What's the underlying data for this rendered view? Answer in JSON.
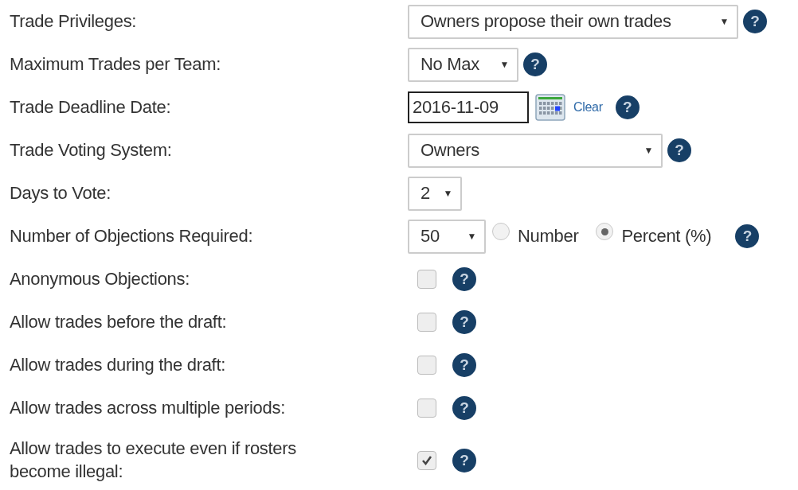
{
  "settings": [
    {
      "kind": "select",
      "label": "Trade Privileges:",
      "value": "Owners propose their own trades",
      "arrow": "▼",
      "help": "?"
    },
    {
      "kind": "select",
      "label": "Maximum Trades per Team:",
      "value": "No Max",
      "arrow": "▼",
      "help": "?"
    },
    {
      "kind": "date",
      "label": "Trade Deadline Date:",
      "value": "2016-11-09",
      "link": "Clear",
      "help": "?"
    },
    {
      "kind": "select",
      "label": "Trade Voting System:",
      "value": "Owners",
      "arrow": "▼",
      "help": "?"
    },
    {
      "kind": "select",
      "label": "Days to Vote:",
      "value": "2",
      "arrow": "▼"
    },
    {
      "kind": "radio-select",
      "label": "Number of Objections Required:",
      "value": "50",
      "arrow": "▼",
      "options": [
        {
          "label": "Number",
          "selected": false
        },
        {
          "label": "Percent (%)",
          "selected": true
        }
      ],
      "help": "?"
    },
    {
      "kind": "checkbox",
      "label": "Anonymous Objections:",
      "checked": false,
      "help": "?"
    },
    {
      "kind": "checkbox",
      "label": "Allow trades before the draft:",
      "checked": false,
      "help": "?"
    },
    {
      "kind": "checkbox",
      "label": "Allow trades during the draft:",
      "checked": false,
      "help": "?"
    },
    {
      "kind": "checkbox",
      "label": "Allow trades across multiple periods:",
      "checked": false,
      "help": "?"
    },
    {
      "kind": "checkbox",
      "label": "Allow trades to execute even if rosters become illegal:",
      "checked": true,
      "help": "?"
    }
  ]
}
